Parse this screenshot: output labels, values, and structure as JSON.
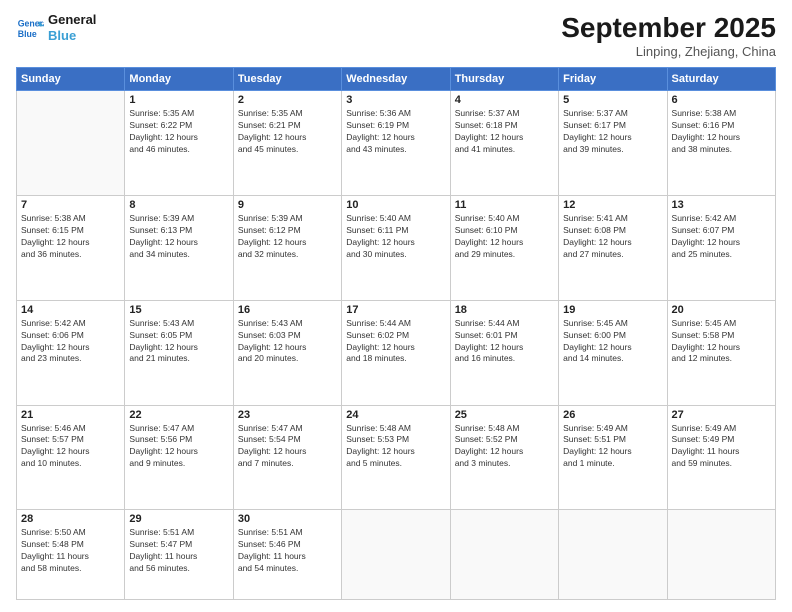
{
  "header": {
    "logo_line1": "General",
    "logo_line2": "Blue",
    "month_title": "September 2025",
    "location": "Linping, Zhejiang, China"
  },
  "days_of_week": [
    "Sunday",
    "Monday",
    "Tuesday",
    "Wednesday",
    "Thursday",
    "Friday",
    "Saturday"
  ],
  "weeks": [
    [
      {
        "day": "",
        "info": ""
      },
      {
        "day": "1",
        "info": "Sunrise: 5:35 AM\nSunset: 6:22 PM\nDaylight: 12 hours\nand 46 minutes."
      },
      {
        "day": "2",
        "info": "Sunrise: 5:35 AM\nSunset: 6:21 PM\nDaylight: 12 hours\nand 45 minutes."
      },
      {
        "day": "3",
        "info": "Sunrise: 5:36 AM\nSunset: 6:19 PM\nDaylight: 12 hours\nand 43 minutes."
      },
      {
        "day": "4",
        "info": "Sunrise: 5:37 AM\nSunset: 6:18 PM\nDaylight: 12 hours\nand 41 minutes."
      },
      {
        "day": "5",
        "info": "Sunrise: 5:37 AM\nSunset: 6:17 PM\nDaylight: 12 hours\nand 39 minutes."
      },
      {
        "day": "6",
        "info": "Sunrise: 5:38 AM\nSunset: 6:16 PM\nDaylight: 12 hours\nand 38 minutes."
      }
    ],
    [
      {
        "day": "7",
        "info": "Sunrise: 5:38 AM\nSunset: 6:15 PM\nDaylight: 12 hours\nand 36 minutes."
      },
      {
        "day": "8",
        "info": "Sunrise: 5:39 AM\nSunset: 6:13 PM\nDaylight: 12 hours\nand 34 minutes."
      },
      {
        "day": "9",
        "info": "Sunrise: 5:39 AM\nSunset: 6:12 PM\nDaylight: 12 hours\nand 32 minutes."
      },
      {
        "day": "10",
        "info": "Sunrise: 5:40 AM\nSunset: 6:11 PM\nDaylight: 12 hours\nand 30 minutes."
      },
      {
        "day": "11",
        "info": "Sunrise: 5:40 AM\nSunset: 6:10 PM\nDaylight: 12 hours\nand 29 minutes."
      },
      {
        "day": "12",
        "info": "Sunrise: 5:41 AM\nSunset: 6:08 PM\nDaylight: 12 hours\nand 27 minutes."
      },
      {
        "day": "13",
        "info": "Sunrise: 5:42 AM\nSunset: 6:07 PM\nDaylight: 12 hours\nand 25 minutes."
      }
    ],
    [
      {
        "day": "14",
        "info": "Sunrise: 5:42 AM\nSunset: 6:06 PM\nDaylight: 12 hours\nand 23 minutes."
      },
      {
        "day": "15",
        "info": "Sunrise: 5:43 AM\nSunset: 6:05 PM\nDaylight: 12 hours\nand 21 minutes."
      },
      {
        "day": "16",
        "info": "Sunrise: 5:43 AM\nSunset: 6:03 PM\nDaylight: 12 hours\nand 20 minutes."
      },
      {
        "day": "17",
        "info": "Sunrise: 5:44 AM\nSunset: 6:02 PM\nDaylight: 12 hours\nand 18 minutes."
      },
      {
        "day": "18",
        "info": "Sunrise: 5:44 AM\nSunset: 6:01 PM\nDaylight: 12 hours\nand 16 minutes."
      },
      {
        "day": "19",
        "info": "Sunrise: 5:45 AM\nSunset: 6:00 PM\nDaylight: 12 hours\nand 14 minutes."
      },
      {
        "day": "20",
        "info": "Sunrise: 5:45 AM\nSunset: 5:58 PM\nDaylight: 12 hours\nand 12 minutes."
      }
    ],
    [
      {
        "day": "21",
        "info": "Sunrise: 5:46 AM\nSunset: 5:57 PM\nDaylight: 12 hours\nand 10 minutes."
      },
      {
        "day": "22",
        "info": "Sunrise: 5:47 AM\nSunset: 5:56 PM\nDaylight: 12 hours\nand 9 minutes."
      },
      {
        "day": "23",
        "info": "Sunrise: 5:47 AM\nSunset: 5:54 PM\nDaylight: 12 hours\nand 7 minutes."
      },
      {
        "day": "24",
        "info": "Sunrise: 5:48 AM\nSunset: 5:53 PM\nDaylight: 12 hours\nand 5 minutes."
      },
      {
        "day": "25",
        "info": "Sunrise: 5:48 AM\nSunset: 5:52 PM\nDaylight: 12 hours\nand 3 minutes."
      },
      {
        "day": "26",
        "info": "Sunrise: 5:49 AM\nSunset: 5:51 PM\nDaylight: 12 hours\nand 1 minute."
      },
      {
        "day": "27",
        "info": "Sunrise: 5:49 AM\nSunset: 5:49 PM\nDaylight: 11 hours\nand 59 minutes."
      }
    ],
    [
      {
        "day": "28",
        "info": "Sunrise: 5:50 AM\nSunset: 5:48 PM\nDaylight: 11 hours\nand 58 minutes."
      },
      {
        "day": "29",
        "info": "Sunrise: 5:51 AM\nSunset: 5:47 PM\nDaylight: 11 hours\nand 56 minutes."
      },
      {
        "day": "30",
        "info": "Sunrise: 5:51 AM\nSunset: 5:46 PM\nDaylight: 11 hours\nand 54 minutes."
      },
      {
        "day": "",
        "info": ""
      },
      {
        "day": "",
        "info": ""
      },
      {
        "day": "",
        "info": ""
      },
      {
        "day": "",
        "info": ""
      }
    ]
  ]
}
